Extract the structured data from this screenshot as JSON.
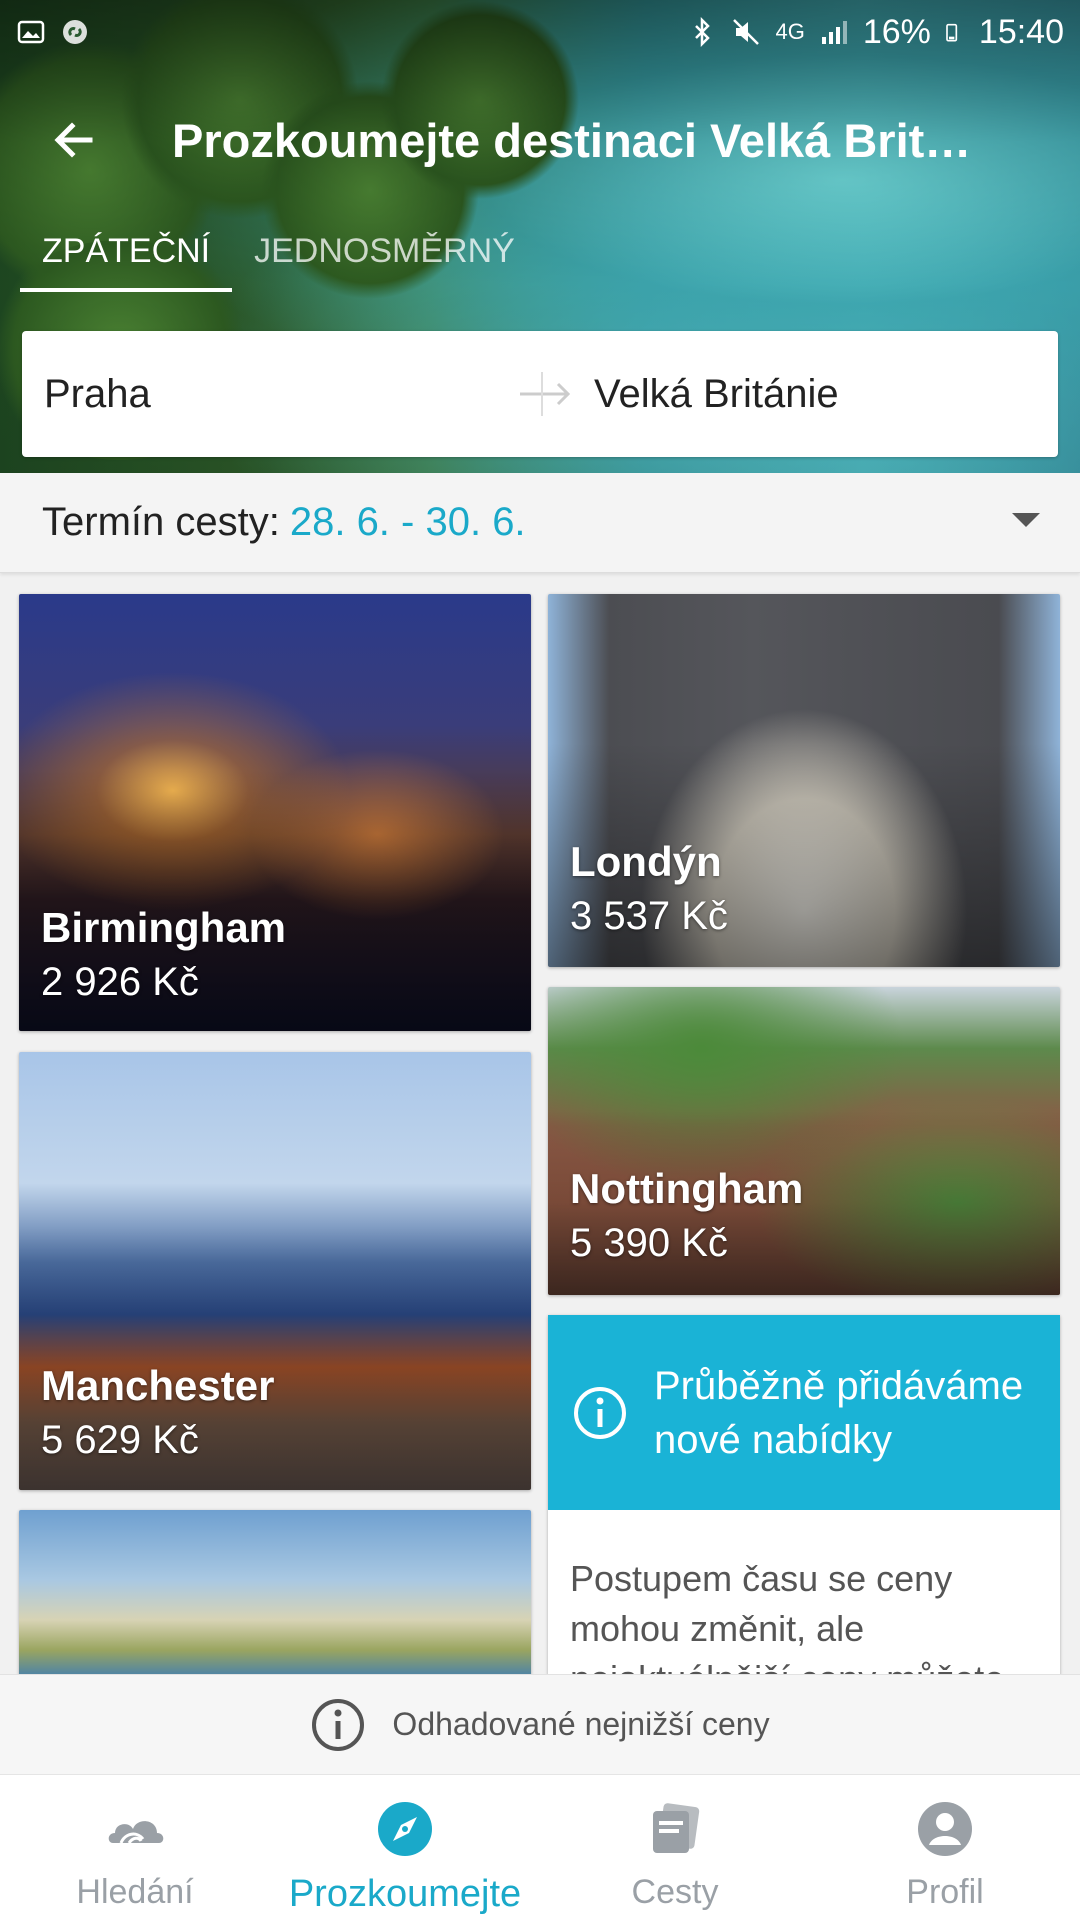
{
  "status_bar": {
    "battery": "16%",
    "time": "15:40",
    "network": "4G"
  },
  "header": {
    "title": "Prozkoumejte destinaci Velká Brit…",
    "tabs": [
      {
        "label": "ZPÁTEČNÍ",
        "active": true
      },
      {
        "label": "JEDNOSMĚRNÝ",
        "active": false
      }
    ],
    "route": {
      "from": "Praha",
      "to": "Velká Británie"
    }
  },
  "date": {
    "label": "Termín cesty:",
    "value": "28. 6. - 30. 6."
  },
  "destinations": [
    {
      "city": "Birmingham",
      "price": "2 926 Kč"
    },
    {
      "city": "Londýn",
      "price": "3 537 Kč"
    },
    {
      "city": "Nottingham",
      "price": "5 390 Kč"
    },
    {
      "city": "Manchester",
      "price": "5 629 Kč"
    }
  ],
  "info_card": {
    "title": "Průběžně přidáváme nové nabídky",
    "body": "Postupem času se ceny mohou změnit, ale nejaktuálnější ceny můžete"
  },
  "note": {
    "text": "Odhadované nejnižší ceny"
  },
  "bottom_nav": [
    {
      "label": "Hledání",
      "icon": "search-cloud-icon"
    },
    {
      "label": "Prozkoumejte",
      "icon": "compass-icon",
      "active": true
    },
    {
      "label": "Cesty",
      "icon": "trips-icon"
    },
    {
      "label": "Profil",
      "icon": "profile-icon"
    }
  ],
  "colors": {
    "accent": "#1aa9c9",
    "info_header": "#1ab3d6",
    "inactive_nav": "#9aa0a6"
  }
}
